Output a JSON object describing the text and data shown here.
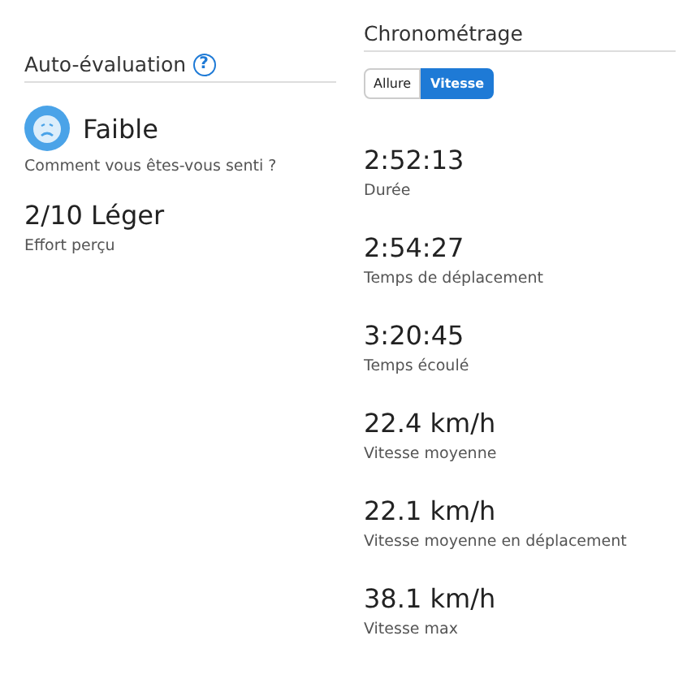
{
  "self_evaluation": {
    "title": "Auto-évaluation",
    "help_icon": "?",
    "feeling": "Faible",
    "feeling_label": "Comment vous êtes-vous senti ?",
    "effort": "2/10 Léger",
    "effort_label": "Effort perçu"
  },
  "timing": {
    "title": "Chronométrage",
    "toggle": [
      {
        "label": "Allure",
        "selected": false
      },
      {
        "label": "Vitesse",
        "selected": true
      }
    ],
    "stats": [
      {
        "value": "2:52:13",
        "label": "Durée"
      },
      {
        "value": "2:54:27",
        "label": "Temps de déplacement"
      },
      {
        "value": "3:20:45",
        "label": "Temps écoulé"
      },
      {
        "value": "22.4 km/h",
        "label": "Vitesse moyenne"
      },
      {
        "value": "22.1 km/h",
        "label": "Vitesse moyenne en déplacement"
      },
      {
        "value": "38.1 km/h",
        "label": "Vitesse max"
      }
    ]
  }
}
